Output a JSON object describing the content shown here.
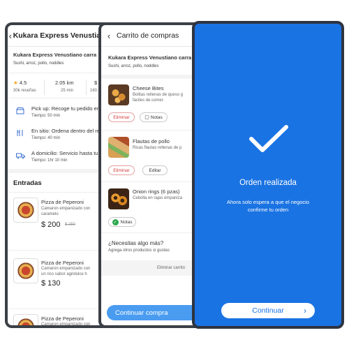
{
  "screen1": {
    "header_title": "Kukara Express Venustiano",
    "restaurant_name": "Kukara Express Venustiano carra",
    "tags": "Sushi, arroz, pollo, noddles",
    "rating": "4.5",
    "reviews": "30k reseñas",
    "distance": "2.05 km",
    "time": "25 min",
    "price_partial": "$",
    "price_sub": "160.0",
    "options": [
      {
        "title": "Pick up: Recoge tu pedido en",
        "sub": "Tiempo: 50 min"
      },
      {
        "title": "En sitio: Ordena dentro del re",
        "sub": "Tiempo: 40 min"
      },
      {
        "title": "A domicilio: Servicio hasta tu",
        "sub": "Tiempo: 1hr 10 min"
      }
    ],
    "section_title": "Entradas",
    "items": [
      {
        "name": "Pizza de Peperoni",
        "desc1": "Camaron empanizado con",
        "desc2": "caramelo",
        "price": "$ 200",
        "old_price": "$ 250"
      },
      {
        "name": "Pizza de Peperoni",
        "desc1": "Camaron empanizado con",
        "desc2": "un rico sabor agridulce h",
        "price": "$ 130",
        "old_price": ""
      },
      {
        "name": "Pizza de Peperoni",
        "desc1": "Camaron empanizado con",
        "desc2": "",
        "price": "",
        "old_price": ""
      }
    ]
  },
  "screen2": {
    "header_title": "Carrito de compras",
    "restaurant_name": "Kukara Express Venustiano carra",
    "tags": "Sushi, arroz, pollo, noddles",
    "items": [
      {
        "name": "Cheese Bites",
        "desc1": "Bolitas rellenas de queso g",
        "desc2": "faciles de comer.",
        "btn1": "Eliminar",
        "btn2": "Notas"
      },
      {
        "name": "Flautas de pollo",
        "desc1": "Ricas flautas rellenas de p",
        "desc2": "",
        "btn1": "Eliminar",
        "btn2": "Editar"
      },
      {
        "name": "Onion rings (6 pzas)",
        "desc1": "Cebolla en rajas empaniza",
        "desc2": "",
        "btn1": "",
        "btn2": "Notas"
      }
    ],
    "upsell_title": "¿Necesitas algo más?",
    "upsell_sub": "Agrega otros productos si gustas",
    "clear_cart": "Eliminar carrito",
    "cta": "Continuar compra"
  },
  "screen3": {
    "title": "Orden realizada",
    "message_line1": "Ahora solo espera a que el negocio",
    "message_line2": "confirme tu orden",
    "button": "Continuar"
  },
  "colors": {
    "primary": "#1a73e3",
    "cta_light": "#4a9cf0",
    "danger": "#d13b3b",
    "success": "#2ea84e"
  }
}
